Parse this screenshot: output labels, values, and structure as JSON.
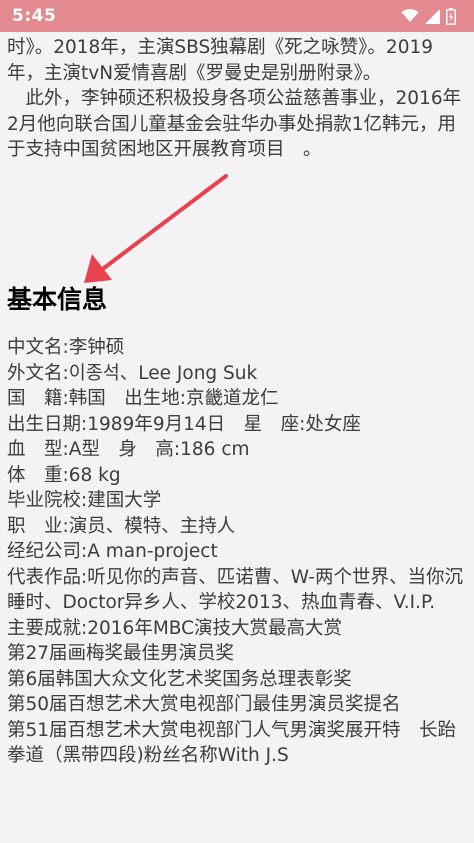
{
  "status_bar": {
    "time": "5:45",
    "icons": [
      "wifi-icon",
      "signal-icon",
      "battery-charging-icon"
    ]
  },
  "article": {
    "para1": "时》。2018年，主演SBS独幕剧《死之咏赞》。2019年，主演tvN爱情喜剧《罗曼史是别册附录》。",
    "para2": "　此外，李钟硕还积极投身各项公益慈善事业，2016年2月他向联合国儿童基金会驻华办事处捐款1亿韩元，用于支持中国贫困地区开展教育项目　。"
  },
  "section_title": "基本信息",
  "info_lines": [
    "中文名:李钟硕",
    "外文名:이종석、Lee Jong Suk",
    "国　籍:韩国　出生地:京畿道龙仁",
    "出生日期:1989年9月14日　星　座:处女座",
    "血　型:A型　身　高:186 cm",
    "体　重:68 kg",
    "毕业院校:建国大学",
    "职　业:演员、模特、主持人",
    "经纪公司:A man-project",
    "代表作品:听见你的声音、匹诺曹、W-两个世界、当你沉睡时、Doctor异乡人、学校2013、热血青春、V.I.P.",
    "主要成就:2016年MBC演技大赏最高大赏",
    "第27届画梅奖最佳男演员奖",
    "第6届韩国大众文化艺术奖国务总理表彰奖",
    "第50届百想艺术大赏电视部门最佳男演员奖提名",
    "第51届百想艺术大赏电视部门人气男演奖展开特　长跆拳道（黑带四段)粉丝名称With J.S"
  ],
  "colors": {
    "status_bar": "#e38a90",
    "annotation_arrow": "#e8424e",
    "background": "#f3f2f4"
  }
}
